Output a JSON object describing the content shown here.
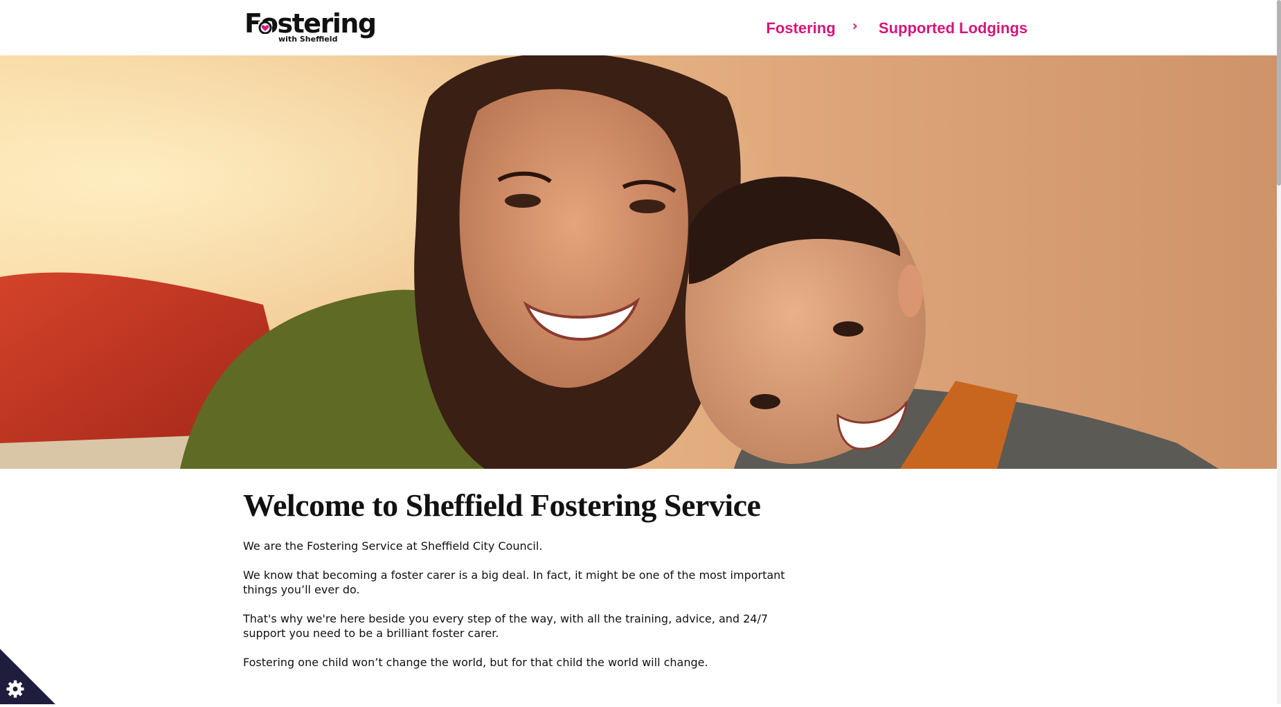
{
  "header": {
    "logo": {
      "word": "Fostering",
      "subtitle": "with Sheffield",
      "alt": "Fostering with Sheffield"
    },
    "nav": {
      "items": [
        {
          "label": "Fostering"
        },
        {
          "label": "Supported Lodgings"
        }
      ],
      "separator": "›"
    }
  },
  "hero": {
    "description": "Smiling woman and boy hugging"
  },
  "main": {
    "title": "Welcome to Sheffield Fostering Service",
    "paragraphs": [
      "We are the Fostering Service at Sheffield City Council.",
      "We know that becoming a foster carer is a big deal. In fact, it might be one of the most important things you’ll ever do.",
      "That's why we're here beside you every step of the way, with all the training, advice, and 24/7 support you need to be a brilliant foster carer.",
      "Fostering one child won’t change the world, but for that child the world will change."
    ]
  },
  "cookie_button": {
    "icon": "gear-icon"
  },
  "colors": {
    "brand_pink": "#d4177a",
    "text": "#111111",
    "cookie_bg": "#1f1d3d"
  }
}
